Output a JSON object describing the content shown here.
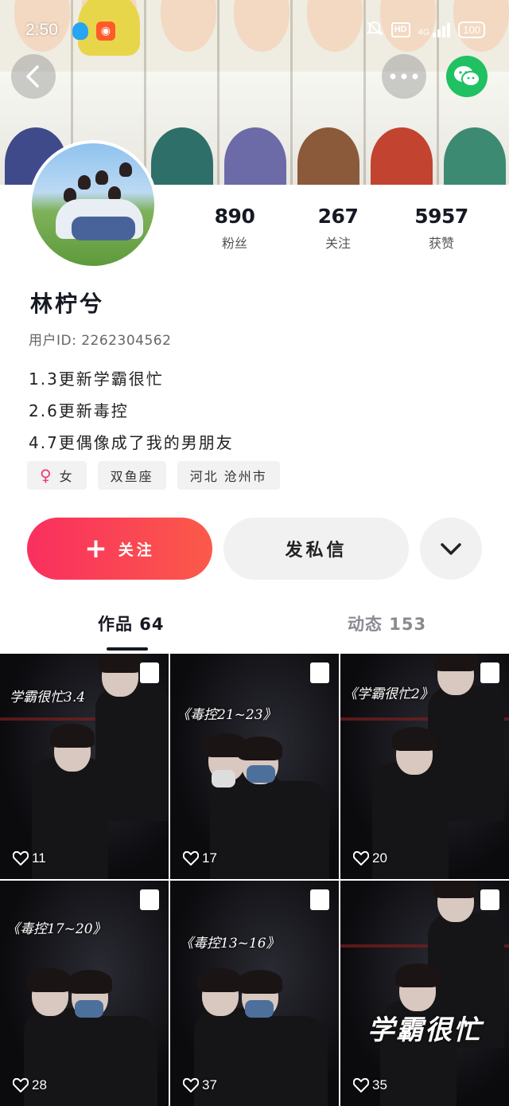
{
  "status_bar": {
    "time": "2:50",
    "network": "4G",
    "battery": "100",
    "hd": "HD"
  },
  "header": {
    "back_icon": "back-arrow-icon",
    "more_icon": "more-icon",
    "share_icon": "wechat-icon"
  },
  "profile": {
    "stats": [
      {
        "value": "890",
        "label": "粉丝"
      },
      {
        "value": "267",
        "label": "关注"
      },
      {
        "value": "5957",
        "label": "获赞"
      }
    ],
    "name": "林柠兮",
    "user_id": "用户ID: 2262304562",
    "bio": [
      "1.3更新学霸很忙",
      "2.6更新毒控",
      "4.7更偶像成了我的男朋友"
    ],
    "tags": {
      "gender_symbol": "♀",
      "gender": "女",
      "zodiac": "双鱼座",
      "location": "河北 沧州市"
    }
  },
  "actions": {
    "follow_plus": "+",
    "follow": "关注",
    "message": "发私信"
  },
  "tabs": {
    "works": "作品 64",
    "feed": "动态 153"
  },
  "grid": [
    {
      "caption": "学霸很忙3.4",
      "likes": "11"
    },
    {
      "caption": "《毒控21~23》",
      "likes": "17"
    },
    {
      "caption": "《学霸很忙2》",
      "likes": "20"
    },
    {
      "caption": "《毒控17~20》",
      "likes": "28"
    },
    {
      "caption": "《毒控13~16》",
      "likes": "37"
    },
    {
      "caption": "学霸很忙",
      "likes": "35"
    }
  ],
  "colors": {
    "accent": "#fa2f5f",
    "wechat": "#1fc161",
    "female": "#f2396f"
  }
}
